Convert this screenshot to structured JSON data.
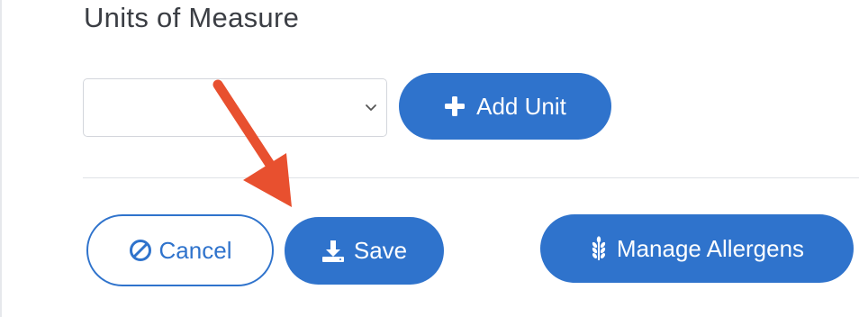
{
  "section": {
    "title": "Units of Measure"
  },
  "unit_select": {
    "value": ""
  },
  "buttons": {
    "add_unit": "Add Unit",
    "cancel": "Cancel",
    "save": "Save",
    "manage_allergens": "Manage Allergens"
  },
  "icons": {
    "add_unit": "plus-icon",
    "cancel": "ban-icon",
    "save": "download-icon",
    "manage_allergens": "wheat-icon",
    "select": "chevron-down-icon"
  },
  "colors": {
    "primary": "#2f73cc",
    "annotation_arrow": "#e8502f",
    "title_text": "#3b3e44"
  }
}
